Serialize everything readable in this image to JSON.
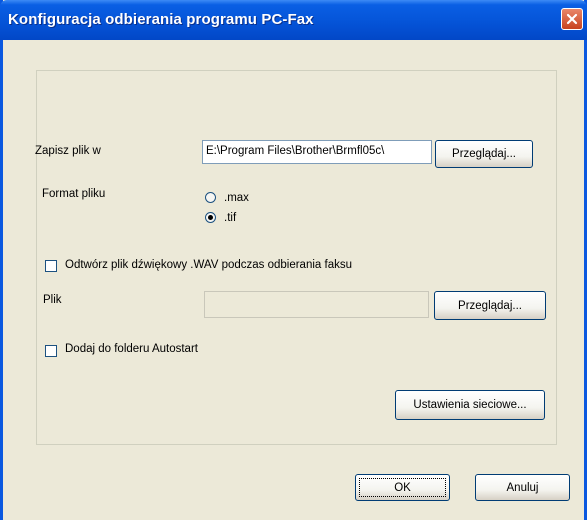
{
  "window": {
    "title": "Konfiguracja odbierania programu PC-Fax"
  },
  "save_location": {
    "label": "Zapisz plik w",
    "path_value": "E:\\Program Files\\Brother\\Brmfl05c\\",
    "browse_label": "Przeglądaj..."
  },
  "file_format": {
    "label": "Format pliku",
    "options": [
      {
        "label": ".max",
        "selected": false
      },
      {
        "label": ".tif",
        "selected": true
      }
    ]
  },
  "wav": {
    "checkbox_label": "Odtwórz plik dźwiękowy .WAV podczas odbierania faksu",
    "checked": false,
    "file_label": "Plik",
    "file_value": "",
    "browse_label": "Przeglądaj..."
  },
  "autostart": {
    "checkbox_label": "Dodaj do folderu Autostart",
    "checked": false
  },
  "network_settings_label": "Ustawienia sieciowe...",
  "buttons": {
    "ok": "OK",
    "cancel": "Anuluj"
  },
  "colors": {
    "titlebar": "#0554d8",
    "dialog_bg": "#ece9d8",
    "close_button": "#c8421f"
  }
}
